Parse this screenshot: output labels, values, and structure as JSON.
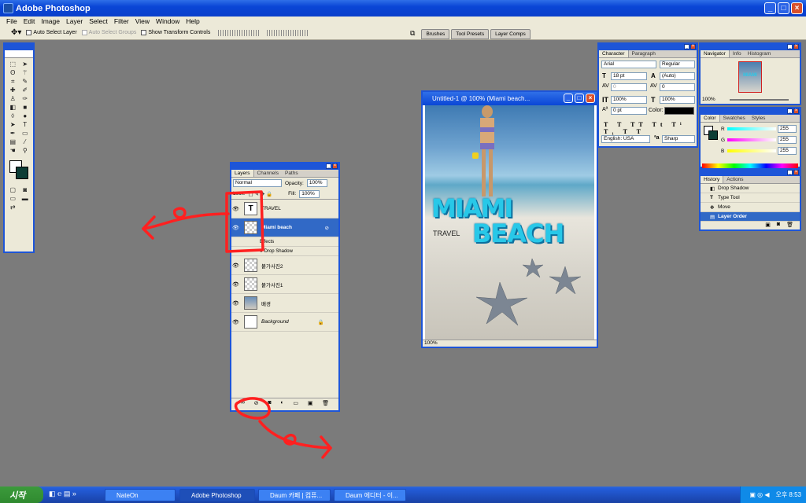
{
  "app": {
    "title": "Adobe Photoshop"
  },
  "menu": [
    "File",
    "Edit",
    "Image",
    "Layer",
    "Select",
    "Filter",
    "View",
    "Window",
    "Help"
  ],
  "options": {
    "auto_select_layer": "Auto Select Layer",
    "auto_select_groups": "Auto Select Groups",
    "show_transform": "Show Transform Controls"
  },
  "well_tabs": [
    "Brushes",
    "Tool Presets",
    "Layer Comps"
  ],
  "layers_panel": {
    "tabs": [
      "Layers",
      "Channels",
      "Paths"
    ],
    "blend_mode": "Normal",
    "opacity_label": "Opacity:",
    "opacity": "100%",
    "lock_label": "Lock:",
    "fill_label": "Fill:",
    "fill": "100%",
    "layers": [
      {
        "name": "TRAVEL",
        "type": "text"
      },
      {
        "name": "Miami      beach",
        "type": "text-selected"
      },
      {
        "name": "붙가사진2",
        "type": "image"
      },
      {
        "name": "붙가사진1",
        "type": "image"
      },
      {
        "name": "배경",
        "type": "image"
      },
      {
        "name": "Background",
        "type": "background"
      }
    ],
    "effects_label": "Effects",
    "drop_shadow_label": "Drop Shadow"
  },
  "document": {
    "title": "Untitled-1 @ 100% (Miami        beach...",
    "zoom": "100%",
    "text_miami": "MIAMI",
    "text_beach": "BEACH",
    "text_travel": "TRAVEL"
  },
  "character_panel": {
    "tabs": [
      "Character",
      "Paragraph"
    ],
    "font": "Arial",
    "style": "Regular",
    "size": "18 pt",
    "leading": "(Auto)",
    "kerning": "0",
    "tracking": "0",
    "vscale": "100%",
    "hscale": "100%",
    "baseline": "0 pt",
    "color_label": "Color:",
    "language": "English: USA",
    "antialias": "Sharp"
  },
  "navigator_panel": {
    "tabs": [
      "Navigator",
      "Info",
      "Histogram"
    ],
    "zoom": "100%"
  },
  "color_panel": {
    "tabs": [
      "Color",
      "Swatches",
      "Styles"
    ],
    "r_label": "R",
    "g_label": "G",
    "b_label": "B",
    "r": "255",
    "g": "255",
    "b": "255"
  },
  "history_panel": {
    "tabs": [
      "History",
      "Actions"
    ],
    "items": [
      "Drop Shadow",
      "Type Tool",
      "Move",
      "Layer Order"
    ]
  },
  "taskbar": {
    "start": "시작",
    "tasks": [
      "NateOn",
      "Adobe Photoshop",
      "Daum 카페 | 컴퓨...",
      "Daum 에디터 - 이..."
    ],
    "clock": "오후 8:53"
  },
  "colors": {
    "accent": "#1d55d8",
    "selected": "#3169c6",
    "annotation": "#ff2020"
  }
}
